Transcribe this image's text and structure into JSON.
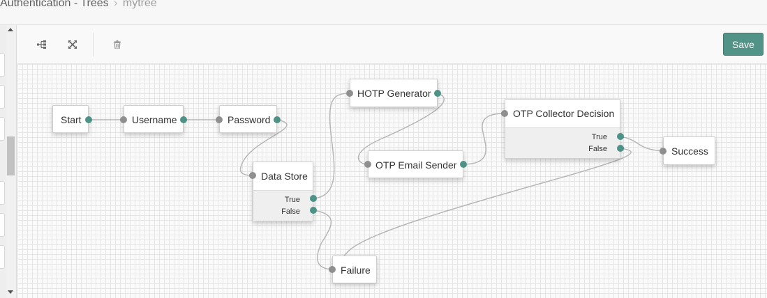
{
  "breadcrumb": {
    "section": "Authentication - Trees",
    "separator": "›",
    "current": "mytree"
  },
  "toolbar": {
    "buttons": [
      {
        "name": "tree-layout",
        "icon": "tree-structure-icon"
      },
      {
        "name": "fullscreen",
        "icon": "expand-arrows-icon"
      },
      {
        "name": "delete",
        "icon": "trash-icon"
      }
    ],
    "save_label": "Save"
  },
  "colors": {
    "accent": "#519387",
    "port_out": "#4d9286",
    "port_in": "#8f8f8f",
    "wire": "#b7b7b7"
  },
  "nodes": {
    "start": {
      "title": "Start"
    },
    "username": {
      "title": "Username"
    },
    "password": {
      "title": "Password"
    },
    "data_store": {
      "title": "Data Store",
      "outcomes": [
        "True",
        "False"
      ]
    },
    "hotp_generator": {
      "title": "HOTP Generator"
    },
    "otp_email_sender": {
      "title": "OTP Email Sender"
    },
    "otp_collector_decision": {
      "title": "OTP Collector Decision",
      "outcomes": [
        "True",
        "False"
      ]
    },
    "success": {
      "title": "Success"
    },
    "failure": {
      "title": "Failure"
    }
  },
  "connections": [
    {
      "from": "start",
      "to": "username"
    },
    {
      "from": "username",
      "to": "password"
    },
    {
      "from": "password",
      "to": "data_store"
    },
    {
      "from": "data_store.True",
      "to": "hotp_generator"
    },
    {
      "from": "data_store.False",
      "to": "failure"
    },
    {
      "from": "hotp_generator",
      "to": "otp_email_sender"
    },
    {
      "from": "otp_email_sender",
      "to": "otp_collector_decision"
    },
    {
      "from": "otp_collector_decision.True",
      "to": "success"
    },
    {
      "from": "otp_collector_decision.False",
      "to": "failure"
    }
  ]
}
